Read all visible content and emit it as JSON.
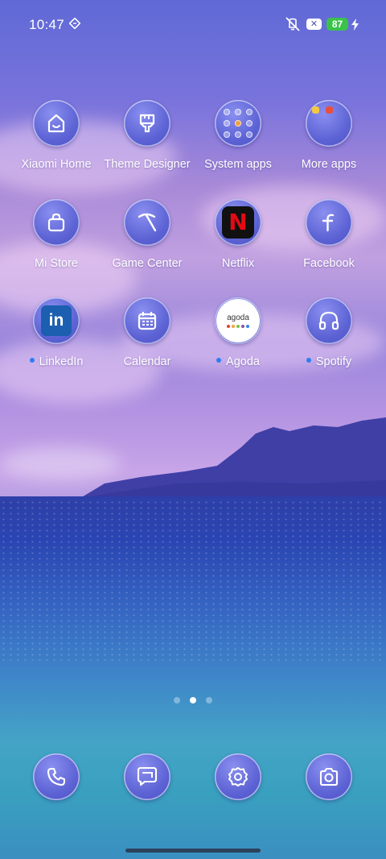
{
  "status_bar": {
    "time": "10:47",
    "battery": "87",
    "x_badge": "✕"
  },
  "apps": [
    {
      "label": "Xiaomi Home",
      "icon": "house-icon",
      "dot": false
    },
    {
      "label": "Theme Designer",
      "icon": "paintbrush-icon",
      "dot": false
    },
    {
      "label": "System apps",
      "icon": "folder-icon",
      "dot": false
    },
    {
      "label": "More apps",
      "icon": "folder-icon",
      "dot": false
    },
    {
      "label": "Mi Store",
      "icon": "shopping-bag-icon",
      "dot": false
    },
    {
      "label": "Game Center",
      "icon": "pickaxe-icon",
      "dot": false
    },
    {
      "label": "Netflix",
      "icon": "netflix-logo",
      "dot": false
    },
    {
      "label": "Facebook",
      "icon": "facebook-icon",
      "dot": false
    },
    {
      "label": "LinkedIn",
      "icon": "linkedin-logo",
      "dot": true
    },
    {
      "label": "Calendar",
      "icon": "calendar-icon",
      "dot": false
    },
    {
      "label": "Agoda",
      "icon": "agoda-logo",
      "dot": true
    },
    {
      "label": "Spotify",
      "icon": "headphones-icon",
      "dot": true
    }
  ],
  "netflix_letter": "N",
  "linkedin_text": "in",
  "agoda_text": "agoda",
  "page_indicator": {
    "count": 3,
    "active": 2
  },
  "dock": [
    "phone-icon",
    "messages-icon",
    "settings-icon",
    "camera-icon"
  ],
  "colors": {
    "battery": "#3ac24a",
    "notification_dot": "#2f7df0",
    "netflix_red": "#e50914",
    "linkedin_blue": "#1c5fb0"
  }
}
